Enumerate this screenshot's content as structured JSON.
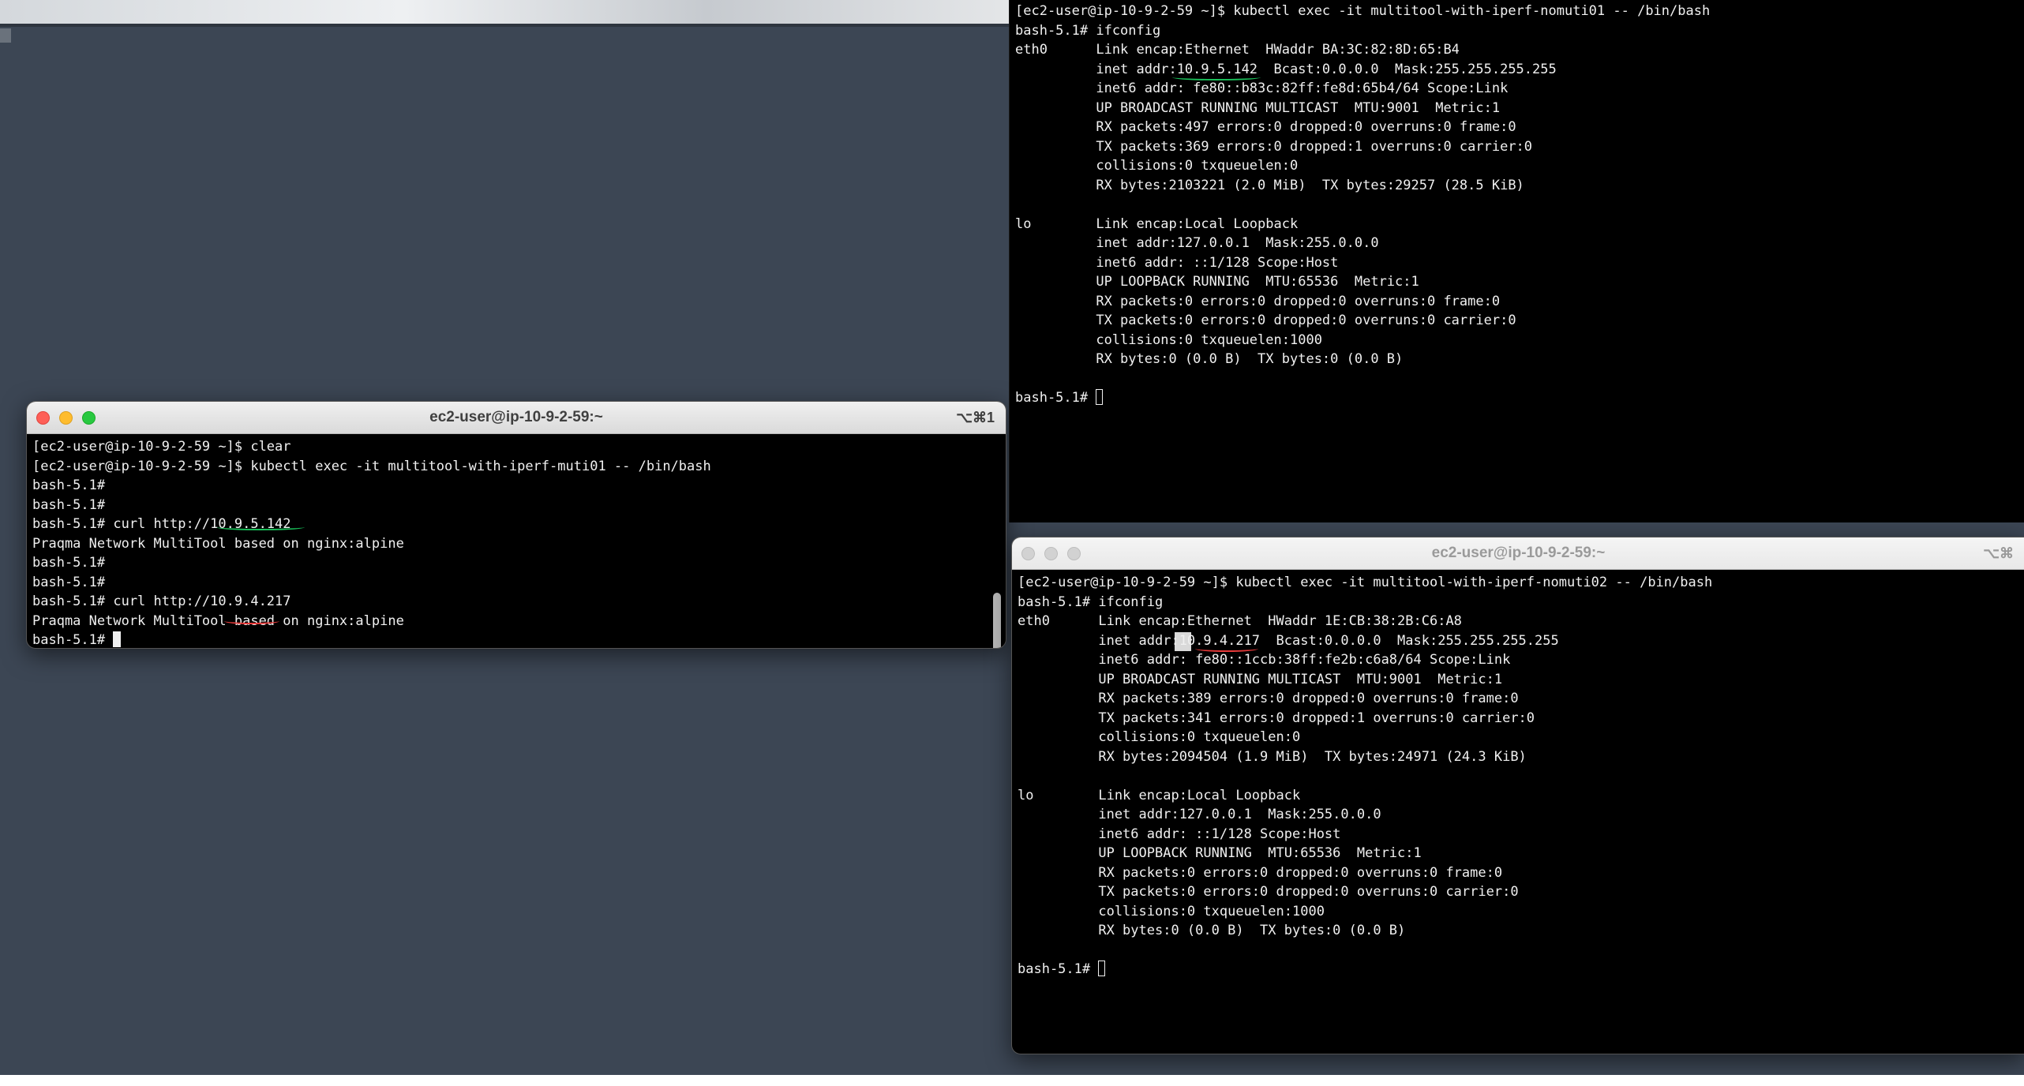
{
  "colors": {
    "desktop": "#3c4654",
    "terminal_bg": "#000000",
    "terminal_fg": "#f0f0f0",
    "annotation_green": "#19c25a",
    "annotation_red": "#e83a3a"
  },
  "terminal_right_top": {
    "lines": [
      "[ec2-user@ip-10-9-2-59 ~]$ kubectl exec -it multitool-with-iperf-nomuti01 -- /bin/bash",
      "bash-5.1# ifconfig",
      "eth0      Link encap:Ethernet  HWaddr BA:3C:82:8D:65:B4  ",
      "          inet addr:10.9.5.142  Bcast:0.0.0.0  Mask:255.255.255.255",
      "          inet6 addr: fe80::b83c:82ff:fe8d:65b4/64 Scope:Link",
      "          UP BROADCAST RUNNING MULTICAST  MTU:9001  Metric:1",
      "          RX packets:497 errors:0 dropped:0 overruns:0 frame:0",
      "          TX packets:369 errors:0 dropped:1 overruns:0 carrier:0",
      "          collisions:0 txqueuelen:0 ",
      "          RX bytes:2103221 (2.0 MiB)  TX bytes:29257 (28.5 KiB)",
      "",
      "lo        Link encap:Local Loopback  ",
      "          inet addr:127.0.0.1  Mask:255.0.0.0",
      "          inet6 addr: ::1/128 Scope:Host",
      "          UP LOOPBACK RUNNING  MTU:65536  Metric:1",
      "          RX packets:0 errors:0 dropped:0 overruns:0 frame:0",
      "          TX packets:0 errors:0 dropped:0 overruns:0 carrier:0",
      "          collisions:0 txqueuelen:1000 ",
      "          RX bytes:0 (0.0 B)  TX bytes:0 (0.0 B)",
      ""
    ],
    "prompt": "bash-5.1# "
  },
  "terminal_left": {
    "title": "ec2-user@ip-10-9-2-59:~",
    "shortcut": "⌥⌘1",
    "lines": [
      "[ec2-user@ip-10-9-2-59 ~]$ clear",
      "[ec2-user@ip-10-9-2-59 ~]$ kubectl exec -it multitool-with-iperf-muti01 -- /bin/bash",
      "bash-5.1# ",
      "bash-5.1# ",
      "bash-5.1# curl http://10.9.5.142",
      "Praqma Network MultiTool based on nginx:alpine",
      "bash-5.1# ",
      "bash-5.1# ",
      "bash-5.1# curl http://10.9.4.217",
      "Praqma Network MultiTool based on nginx:alpine"
    ],
    "prompt": "bash-5.1# "
  },
  "terminal_right_bottom": {
    "title": "ec2-user@ip-10-9-2-59:~",
    "shortcut": "⌥⌘",
    "lines": [
      "[ec2-user@ip-10-9-2-59 ~]$ kubectl exec -it multitool-with-iperf-nomuti02 -- /bin/bash",
      "bash-5.1# ifconfig",
      "eth0      Link encap:Ethernet  HWaddr 1E:CB:38:2B:C6:A8  ",
      "          inet addr:10.9.4.217  Bcast:0.0.0.0  Mask:255.255.255.255",
      "          inet6 addr: fe80::1ccb:38ff:fe2b:c6a8/64 Scope:Link",
      "          UP BROADCAST RUNNING MULTICAST  MTU:9001  Metric:1",
      "          RX packets:389 errors:0 dropped:0 overruns:0 frame:0",
      "          TX packets:341 errors:0 dropped:1 overruns:0 carrier:0",
      "          collisions:0 txqueuelen:0 ",
      "          RX bytes:2094504 (1.9 MiB)  TX bytes:24971 (24.3 KiB)",
      "",
      "lo        Link encap:Local Loopback  ",
      "          inet addr:127.0.0.1  Mask:255.0.0.0",
      "          inet6 addr: ::1/128 Scope:Host",
      "          UP LOOPBACK RUNNING  MTU:65536  Metric:1",
      "          RX packets:0 errors:0 dropped:0 overruns:0 frame:0",
      "          TX packets:0 errors:0 dropped:0 overruns:0 carrier:0",
      "          collisions:0 txqueuelen:1000 ",
      "          RX bytes:0 (0.0 B)  TX bytes:0 (0.0 B)",
      ""
    ],
    "prompt": "bash-5.1# "
  }
}
